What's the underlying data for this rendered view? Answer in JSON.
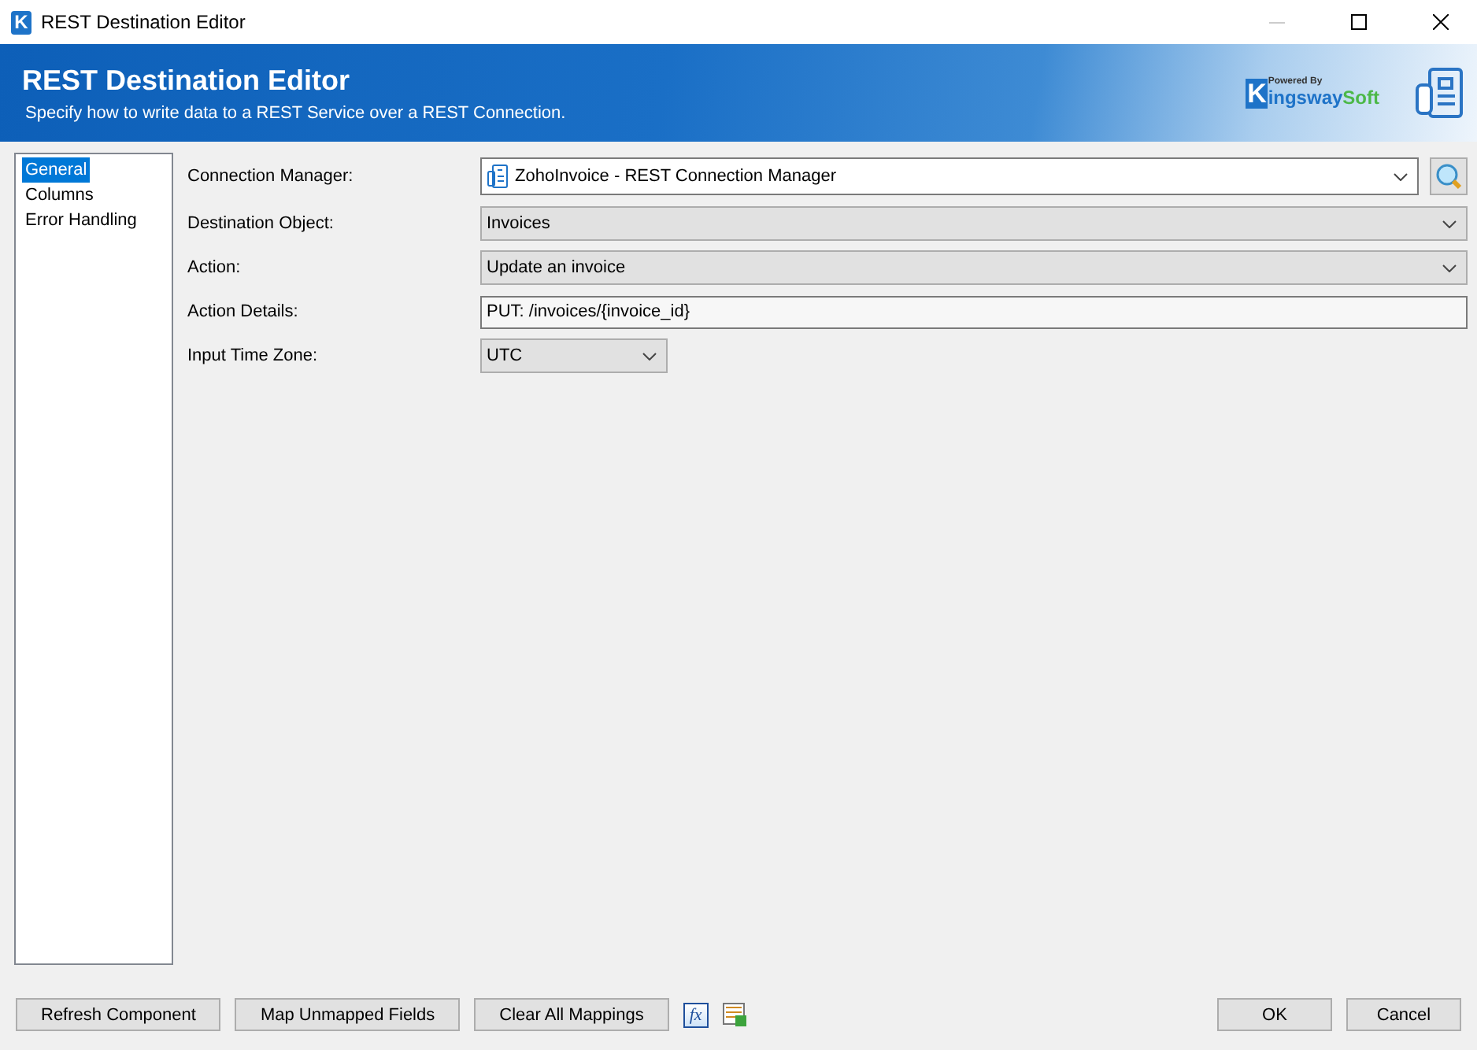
{
  "window": {
    "title": "REST Destination Editor",
    "app_letter": "K"
  },
  "header": {
    "title": "REST Destination Editor",
    "subtitle": "Specify how to write data to a REST Service over a REST Connection.",
    "logo": {
      "powered": "Powered By",
      "letter": "K",
      "name": "ingsway",
      "suffix": "Soft"
    }
  },
  "sidebar": {
    "items": [
      {
        "label": "General",
        "selected": true
      },
      {
        "label": "Columns",
        "selected": false
      },
      {
        "label": "Error Handling",
        "selected": false
      }
    ]
  },
  "fields": [
    {
      "label": "Connection Manager:",
      "kind": "connection",
      "value": "ZohoInvoice - REST Connection Manager",
      "editable": true
    },
    {
      "label": "Destination Object:",
      "kind": "combo",
      "value": "Invoices",
      "editable": false
    },
    {
      "label": "Action:",
      "kind": "combo",
      "value": "Update an invoice",
      "editable": false
    },
    {
      "label": "Action Details:",
      "kind": "text",
      "value": "PUT: /invoices/{invoice_id}"
    },
    {
      "label": "Input Time Zone:",
      "kind": "short_combo",
      "value": "UTC",
      "editable": false
    }
  ],
  "footer": {
    "buttons": [
      "Refresh Component",
      "Map Unmapped Fields",
      "Clear All Mappings"
    ],
    "fx_icon": "fx",
    "dialog_buttons": [
      "OK",
      "Cancel"
    ]
  }
}
